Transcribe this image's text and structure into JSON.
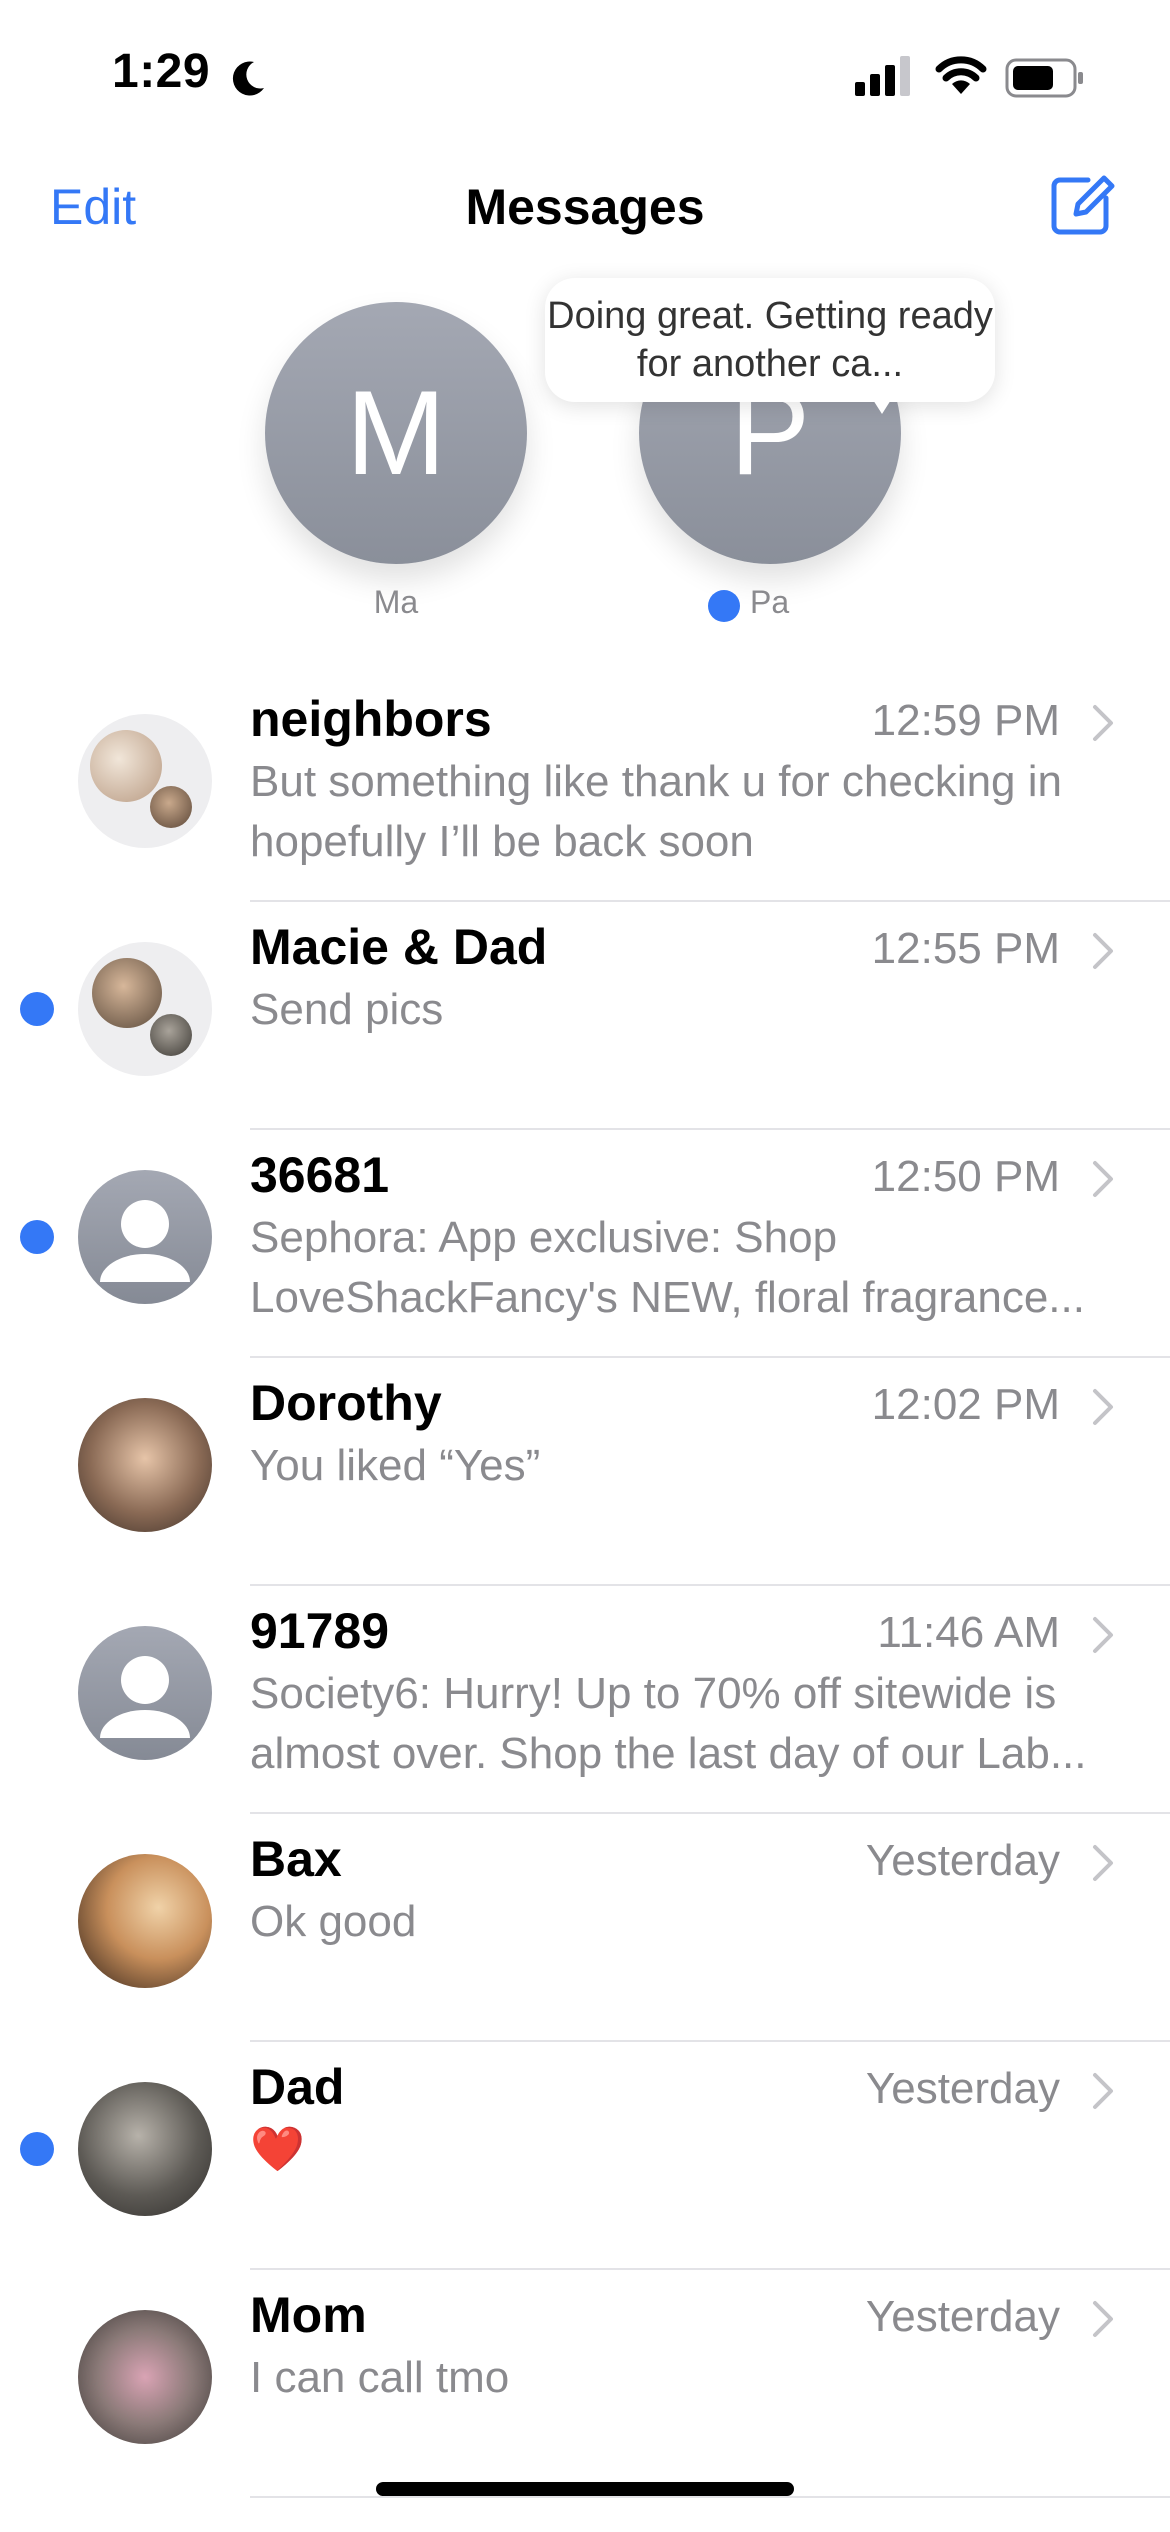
{
  "status_bar": {
    "time": "1:29"
  },
  "nav": {
    "edit_label": "Edit",
    "title": "Messages"
  },
  "pinned": [
    {
      "initial": "M",
      "name": "Ma",
      "unread": false
    },
    {
      "initial": "P",
      "name": "Pa",
      "unread": true,
      "bubble_text": "Doing great. Getting ready for another ca..."
    }
  ],
  "conversations": [
    {
      "name": "neighbors",
      "time": "12:59 PM",
      "preview": "But something like thank u for checking in hopefully I’ll be back soon",
      "unread": false,
      "avatar": "group-photo"
    },
    {
      "name": "Macie & Dad",
      "time": "12:55 PM",
      "preview": "Send pics",
      "unread": true,
      "avatar": "group-photo"
    },
    {
      "name": "36681",
      "time": "12:50 PM",
      "preview": "Sephora: App exclusive: Shop LoveShackFancy's NEW, floral fragrance...",
      "unread": true,
      "avatar": "default-person"
    },
    {
      "name": "Dorothy",
      "time": "12:02 PM",
      "preview": "You liked “Yes”",
      "unread": false,
      "avatar": "photo"
    },
    {
      "name": "91789",
      "time": "11:46 AM",
      "preview": "Society6: Hurry! Up to 70% off sitewide is almost over. Shop the last day of our Lab...",
      "unread": false,
      "avatar": "default-person"
    },
    {
      "name": "Bax",
      "time": "Yesterday",
      "preview": "Ok good",
      "unread": false,
      "avatar": "photo"
    },
    {
      "name": "Dad",
      "time": "Yesterday",
      "preview": "❤️",
      "unread": true,
      "avatar": "photo"
    },
    {
      "name": "Mom",
      "time": "Yesterday",
      "preview": "I can call tmo",
      "unread": false,
      "avatar": "photo"
    }
  ],
  "colors": {
    "accent": "#3478F6",
    "secondary_text": "#8a8a8e"
  }
}
